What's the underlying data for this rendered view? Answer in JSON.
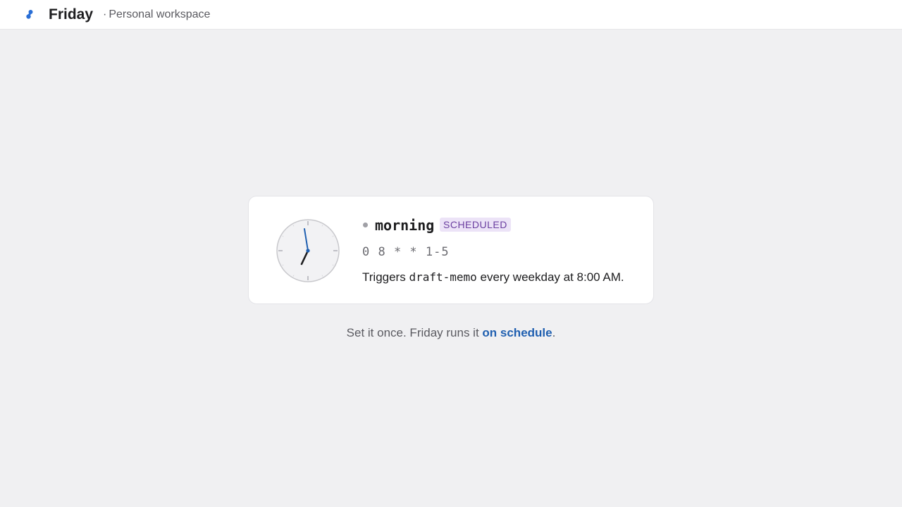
{
  "header": {
    "app_name": "Friday",
    "workspace_sep": "·",
    "workspace_label": "Personal workspace"
  },
  "job": {
    "name": "morning",
    "status_badge": "SCHEDULED",
    "cron": "0 8 * * 1-5",
    "description_prefix": "Triggers ",
    "description_target": "draft-memo",
    "description_suffix": " every weekday at 8:00 AM.",
    "clock_time": "7:58"
  },
  "tagline": {
    "prefix": "Set it once. Friday runs it ",
    "link_text": "on schedule",
    "suffix": "."
  },
  "colors": {
    "accent": "#1f5fb0",
    "badge_bg": "#ece3f7",
    "badge_text": "#6b3fa0",
    "background": "#f0f0f2"
  }
}
